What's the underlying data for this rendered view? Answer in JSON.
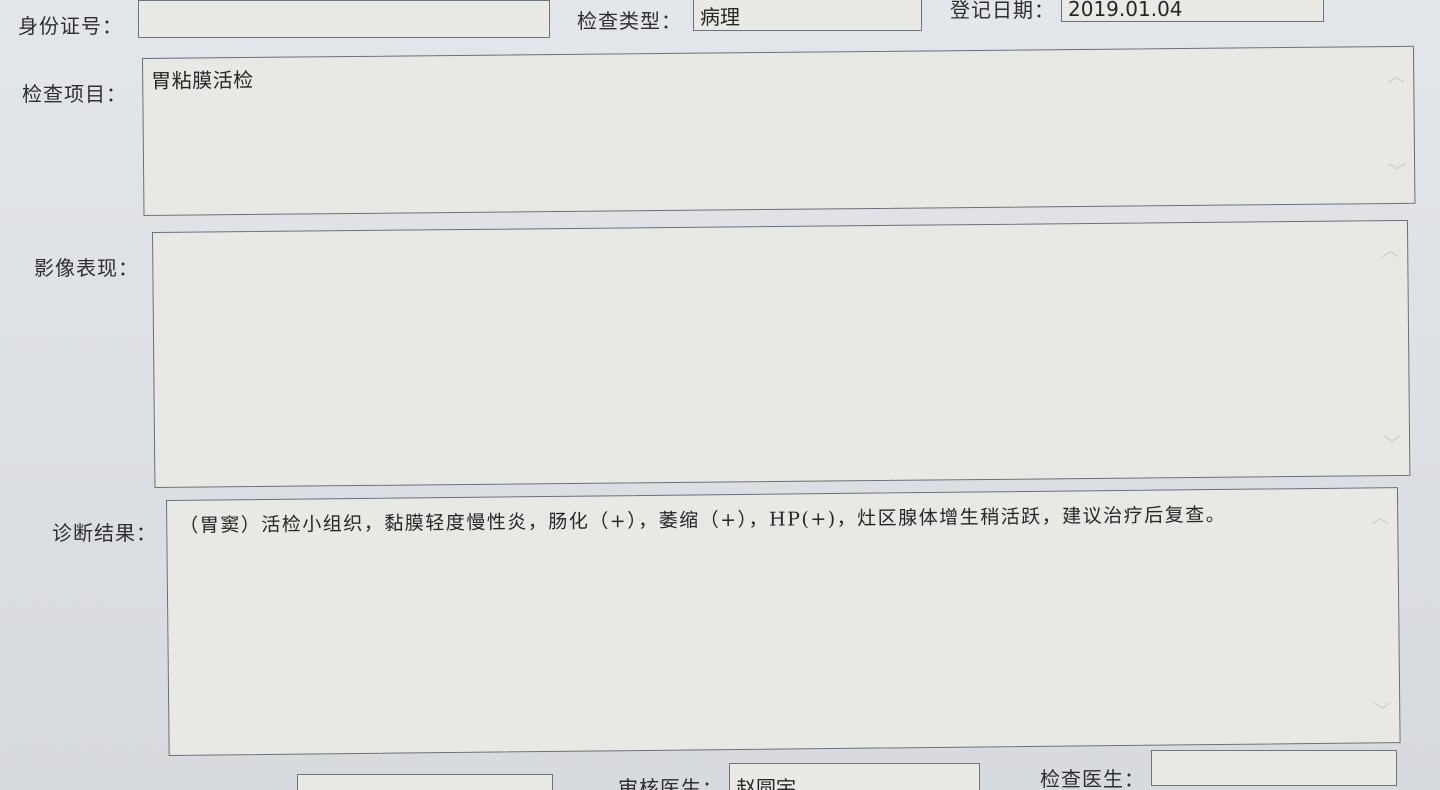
{
  "labels": {
    "id_number": "身份证号：",
    "exam_type": "检查类型：",
    "register_date": "登记日期：",
    "exam_item": "检查项目：",
    "imaging": "影像表现：",
    "diagnosis": "诊断结果：",
    "review_doctor": "审核医生：",
    "exam_doctor": "检查医生："
  },
  "values": {
    "id_number": "",
    "exam_type": "病理",
    "register_date": "2019.01.04",
    "exam_item": "胃粘膜活检",
    "imaging": "",
    "diagnosis": "（胃窦）活检小组织，黏膜轻度慢性炎，肠化（+），萎缩（+），HP(+)，灶区腺体增生稍活跃，建议治疗后复查。",
    "review_doctor": "赵圆宇",
    "exam_doctor": ""
  },
  "icons": {
    "scroll_up": "chevron-up-icon",
    "scroll_down": "chevron-down-icon"
  }
}
